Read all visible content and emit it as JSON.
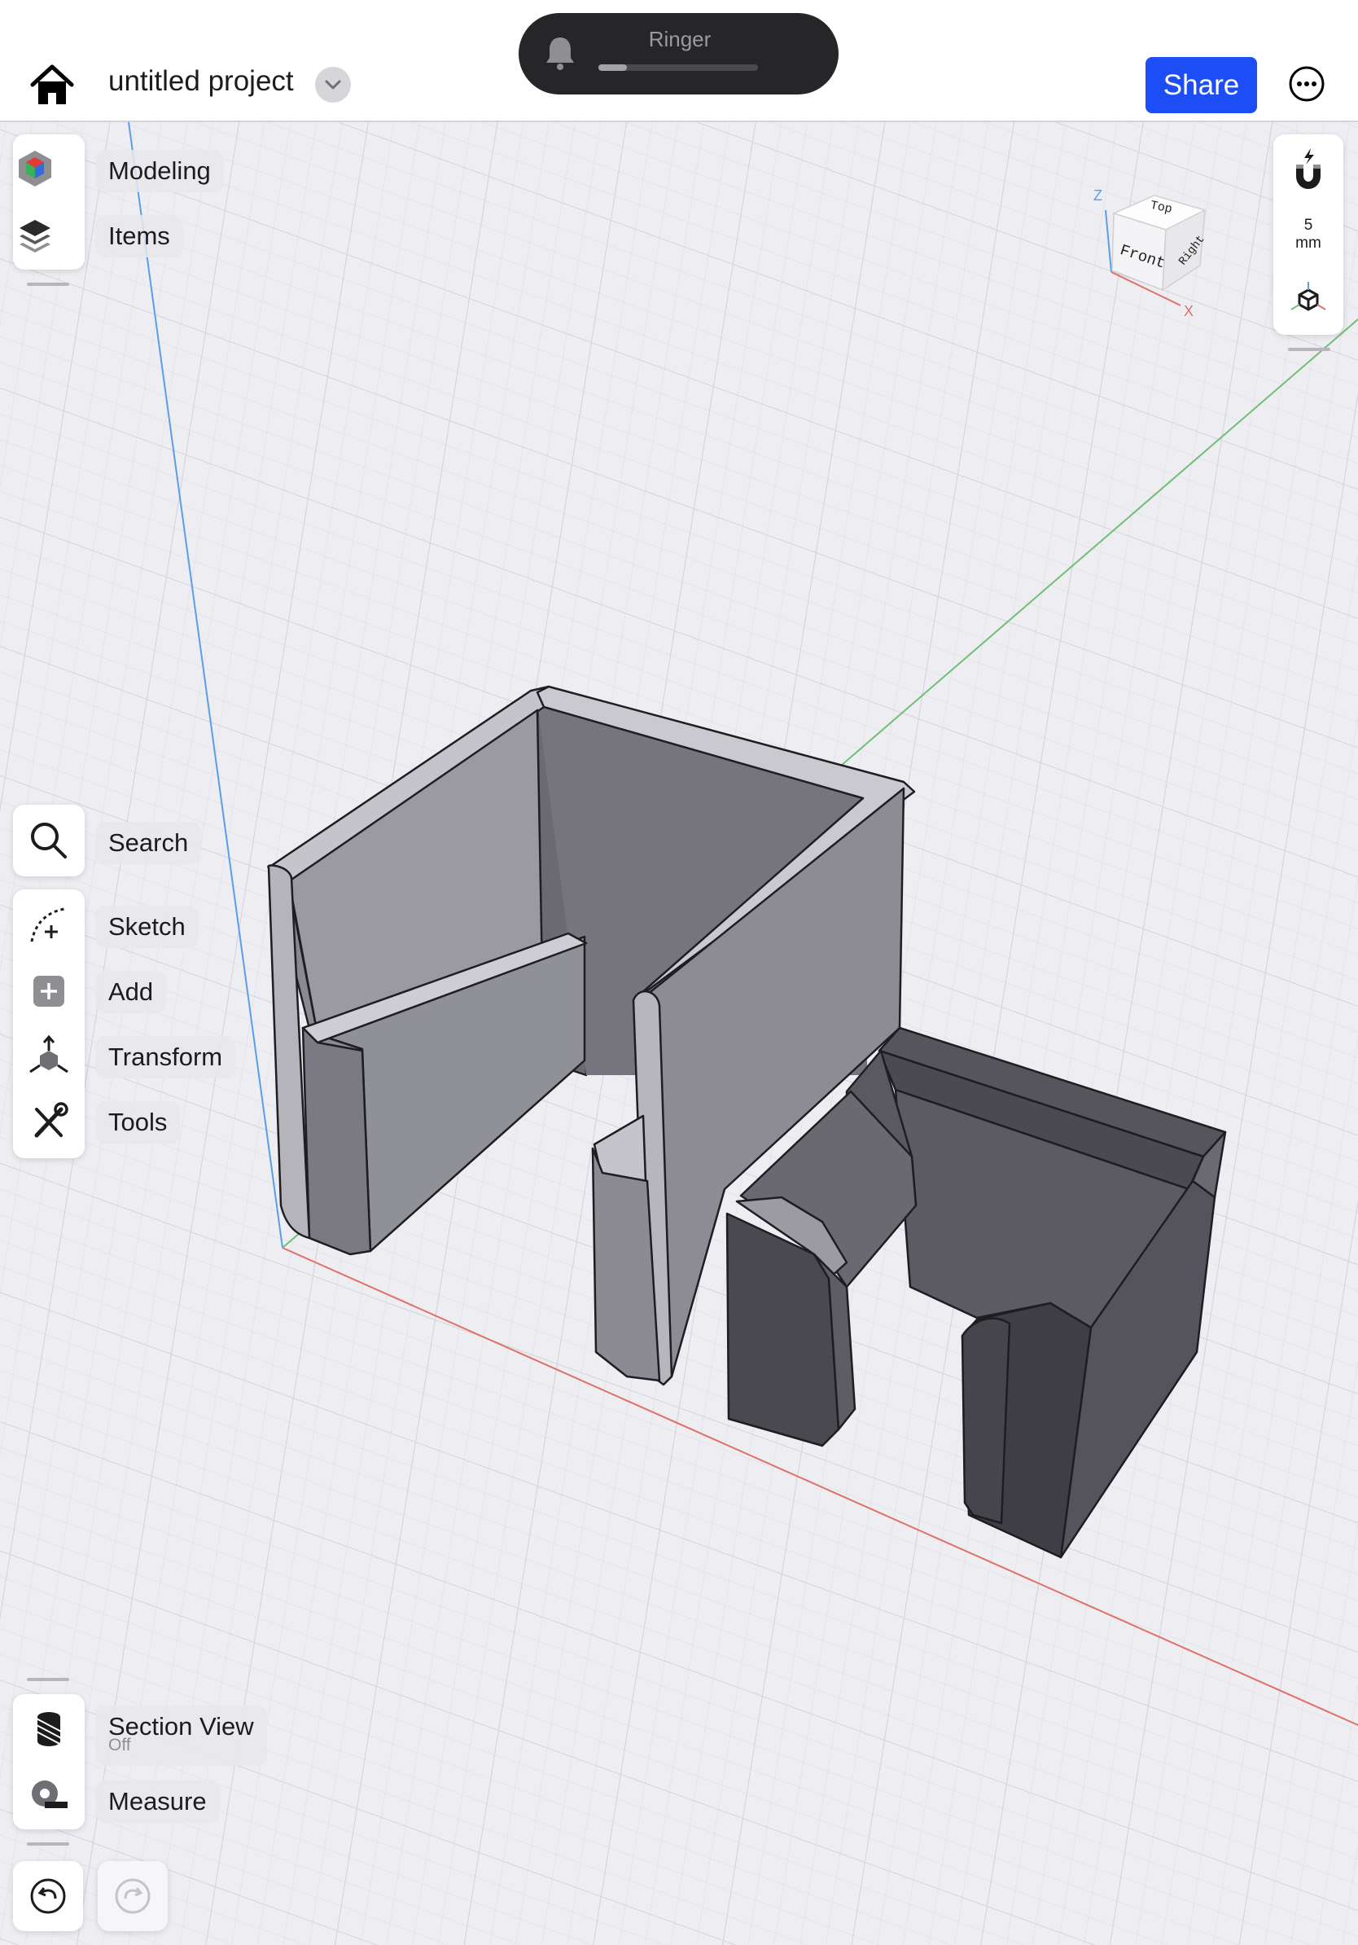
{
  "header": {
    "project_title": "untitled project",
    "share_label": "Share"
  },
  "ringer": {
    "label": "Ringer",
    "volume_fraction": 0.18
  },
  "top_panel": {
    "items": [
      {
        "label": "Modeling",
        "icon": "modeling-cube-icon"
      },
      {
        "label": "Items",
        "icon": "layers-icon"
      }
    ]
  },
  "tool_panel": {
    "search_label": "Search",
    "items": [
      {
        "label": "Sketch",
        "icon": "sketch-icon"
      },
      {
        "label": "Add",
        "icon": "add-icon"
      },
      {
        "label": "Transform",
        "icon": "transform-icon"
      },
      {
        "label": "Tools",
        "icon": "tools-icon"
      }
    ]
  },
  "bottom_panel": {
    "section_view_label": "Section View",
    "section_view_state": "Off",
    "measure_label": "Measure"
  },
  "right_panel": {
    "grid_value": "5",
    "grid_unit": "mm"
  },
  "view_cube": {
    "top": "Top",
    "front": "Front",
    "right": "Right",
    "axis_z": "Z",
    "axis_x": "X"
  },
  "colors": {
    "accent": "#1d4ef5",
    "x_axis": "#e0706a",
    "y_axis": "#6fbf78",
    "z_axis": "#5b9ee8",
    "grid_bg": "#eeedf2"
  }
}
